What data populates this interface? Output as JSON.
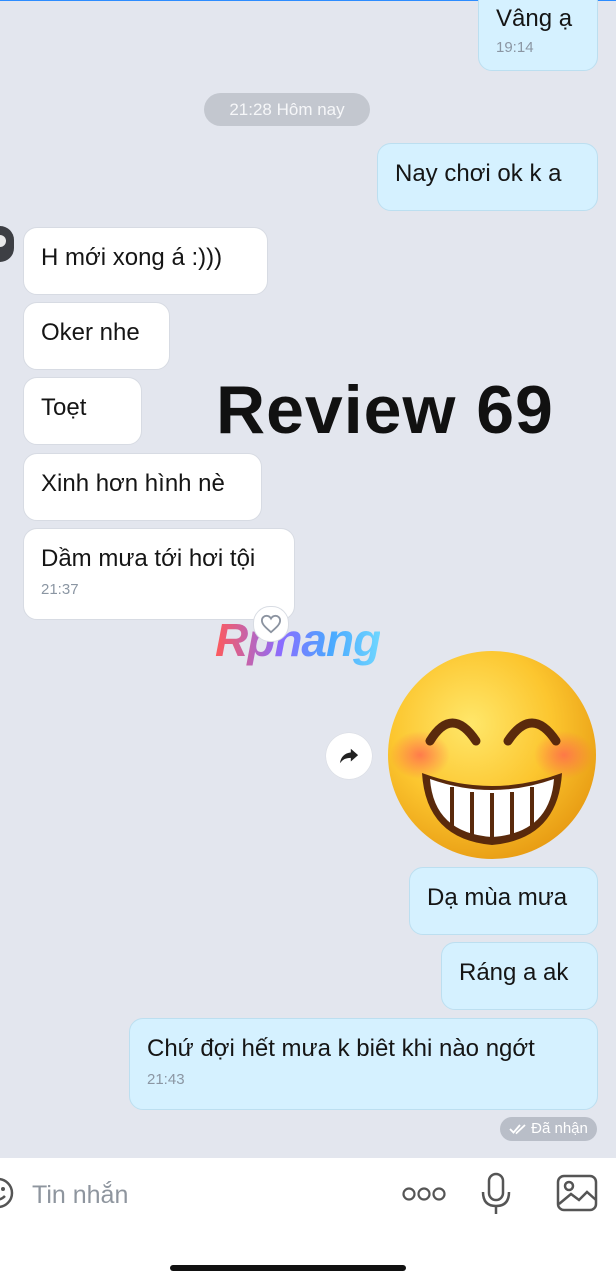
{
  "messages_top": {
    "vang_a": {
      "text": "Vâng ạ",
      "time": "19:14"
    },
    "date_separator": "21:28 Hôm nay",
    "nay_choi": {
      "text": "Nay chơi ok k a"
    }
  },
  "incoming": [
    {
      "text": "H mới xong á :)))"
    },
    {
      "text": "Oker nhe"
    },
    {
      "text": "Toẹt"
    },
    {
      "text": "Xinh hơn hình nè"
    },
    {
      "text": "Dầm mưa tới hơi tội",
      "time": "21:37"
    }
  ],
  "overlay": {
    "title": "Review 69",
    "watermark": "Rphang"
  },
  "sticker": {
    "icon": "grinning-face-sticker",
    "share_icon": "share-arrow-icon"
  },
  "outgoing_bottom": [
    {
      "text": "Dạ mùa mưa"
    },
    {
      "text": "Ráng a ak"
    },
    {
      "text": "Chứ đợi hết mưa k biêt khi nào ngớt",
      "time": "21:43"
    }
  ],
  "status": {
    "received": "Đã nhận"
  },
  "composer": {
    "placeholder": "Tin nhắn",
    "icons": [
      "emoji-icon",
      "more-icon",
      "microphone-icon",
      "image-icon"
    ]
  },
  "colors": {
    "background": "#e3e6ee",
    "outgoing_bubble": "#d5f1ff",
    "incoming_bubble": "#ffffff",
    "accent": "#2d8cff"
  }
}
